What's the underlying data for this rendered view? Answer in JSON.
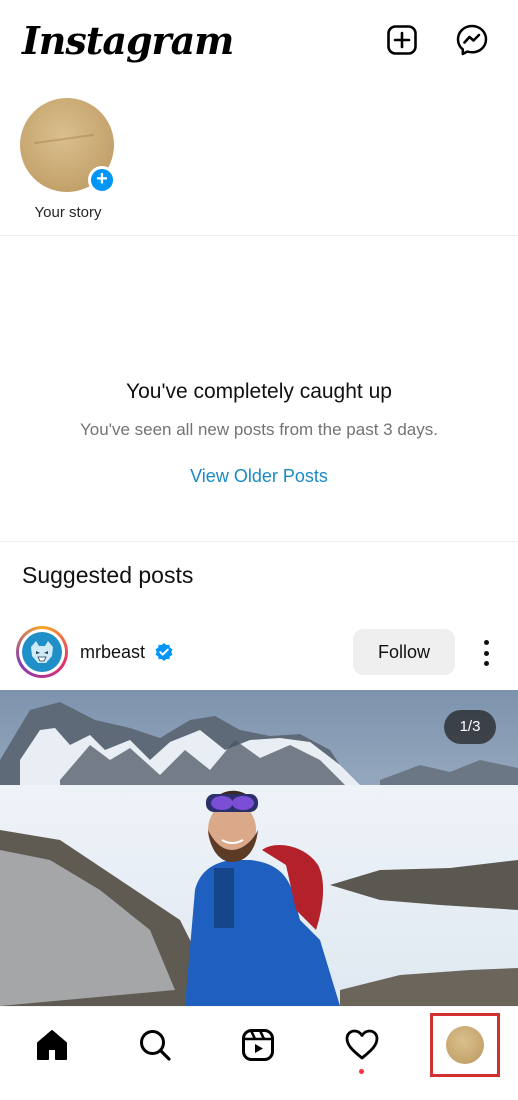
{
  "header": {
    "logo_text": "Instagram",
    "add_icon": "plus-square-icon",
    "messenger_icon": "messenger-icon"
  },
  "stories": {
    "items": [
      {
        "label": "Your story",
        "badge": "+"
      }
    ]
  },
  "feed_status": {
    "title": "You've completely caught up",
    "subtitle": "You've seen all new posts from the past 3 days.",
    "link_label": "View Older Posts"
  },
  "suggested": {
    "heading": "Suggested posts"
  },
  "post": {
    "username": "mrbeast",
    "verified": true,
    "follow_label": "Follow",
    "image_counter": "1/3"
  },
  "tabbar": {
    "items": [
      "home-icon",
      "search-icon",
      "reels-icon",
      "heart-icon",
      "profile-avatar"
    ]
  },
  "colors": {
    "link": "#1a8ac5",
    "verified": "#0095f6",
    "highlight_box": "#d32f2f",
    "notification_dot": "#ff3040"
  }
}
